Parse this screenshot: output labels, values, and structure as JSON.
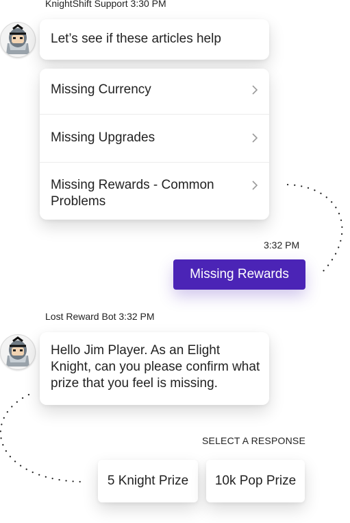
{
  "conversation": {
    "first_sender": "KnightShift Support",
    "first_time": "3:30 PM",
    "first_message": "Let’s see if these articles help",
    "articles": [
      {
        "label": "Missing Currency"
      },
      {
        "label": "Missing Upgrades"
      },
      {
        "label": "Missing Rewards - Common Problems"
      }
    ],
    "user_time": "3:32 PM",
    "user_message": "Missing Rewards",
    "second_sender": "Lost Reward Bot",
    "second_time": "3:32 PM",
    "second_message": "Hello Jim Player. As an Elight Knight, can you please confirm what prize that you feel is missing."
  },
  "responses": {
    "label": "SELECT A RESPONSE",
    "options": [
      {
        "label": "5 Knight Prize"
      },
      {
        "label": "10k Pop Prize"
      }
    ]
  },
  "colors": {
    "accent": "#4b24b6"
  },
  "icons": {
    "avatar": "knight-avatar-icon",
    "chevron": "chevron-right-icon"
  }
}
